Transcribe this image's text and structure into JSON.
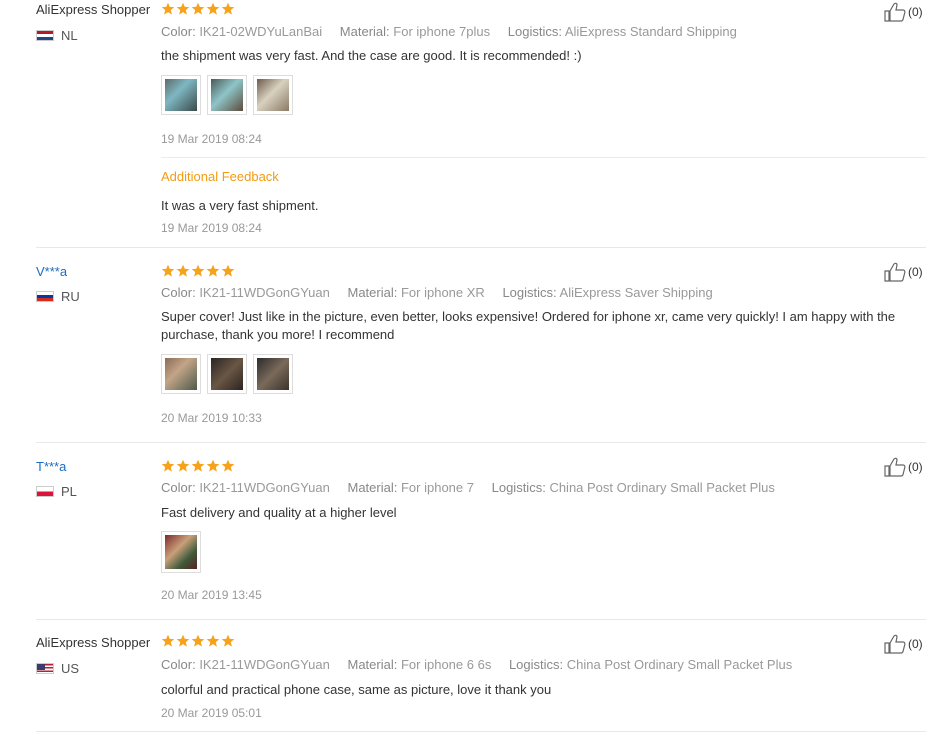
{
  "labels": {
    "color": "Color:",
    "material": "Material:",
    "logistics": "Logistics:",
    "additional_feedback": "Additional Feedback"
  },
  "reviews": [
    {
      "user": "AliExpress Shopper",
      "country": "NL",
      "rating": 5,
      "likes": "(0)",
      "color": "IK21-02WDYuLanBai",
      "material": "For iphone 7plus",
      "logistics": "AliExpress Standard Shipping",
      "text": "the shipment was very fast. And the case are good. It is recommended! :)",
      "date": "19 Mar 2019 08:24",
      "additional_text": "It was a very fast shipment.",
      "additional_date": "19 Mar 2019 08:24"
    },
    {
      "user": "V***a",
      "country": "RU",
      "rating": 5,
      "likes": "(0)",
      "color": "IK21-11WDGonGYuan",
      "material": "For iphone XR",
      "logistics": "AliExpress Saver Shipping",
      "text": "Super cover! Just like in the picture, even better, looks expensive! Ordered for iphone xr, came very quickly! I am happy with the purchase, thank you more! I recommend",
      "date": "20 Mar 2019 10:33"
    },
    {
      "user": "T***a",
      "country": "PL",
      "rating": 5,
      "likes": "(0)",
      "color": "IK21-11WDGonGYuan",
      "material": "For iphone 7",
      "logistics": "China Post Ordinary Small Packet Plus",
      "text": "Fast delivery and quality at a higher level",
      "date": "20 Mar 2019 13:45"
    },
    {
      "user": "AliExpress Shopper",
      "country": "US",
      "rating": 5,
      "likes": "(0)",
      "color": "IK21-11WDGonGYuan",
      "material": "For iphone 6 6s",
      "logistics": "China Post Ordinary Small Packet Plus",
      "text": "colorful and practical phone case, same as picture, love it thank you",
      "date": "20 Mar 2019 05:01"
    }
  ],
  "colors": {
    "star": "#f7a21b",
    "link": "#1a6dbf",
    "additional_feedback": "#f39c12",
    "muted": "#999999"
  }
}
